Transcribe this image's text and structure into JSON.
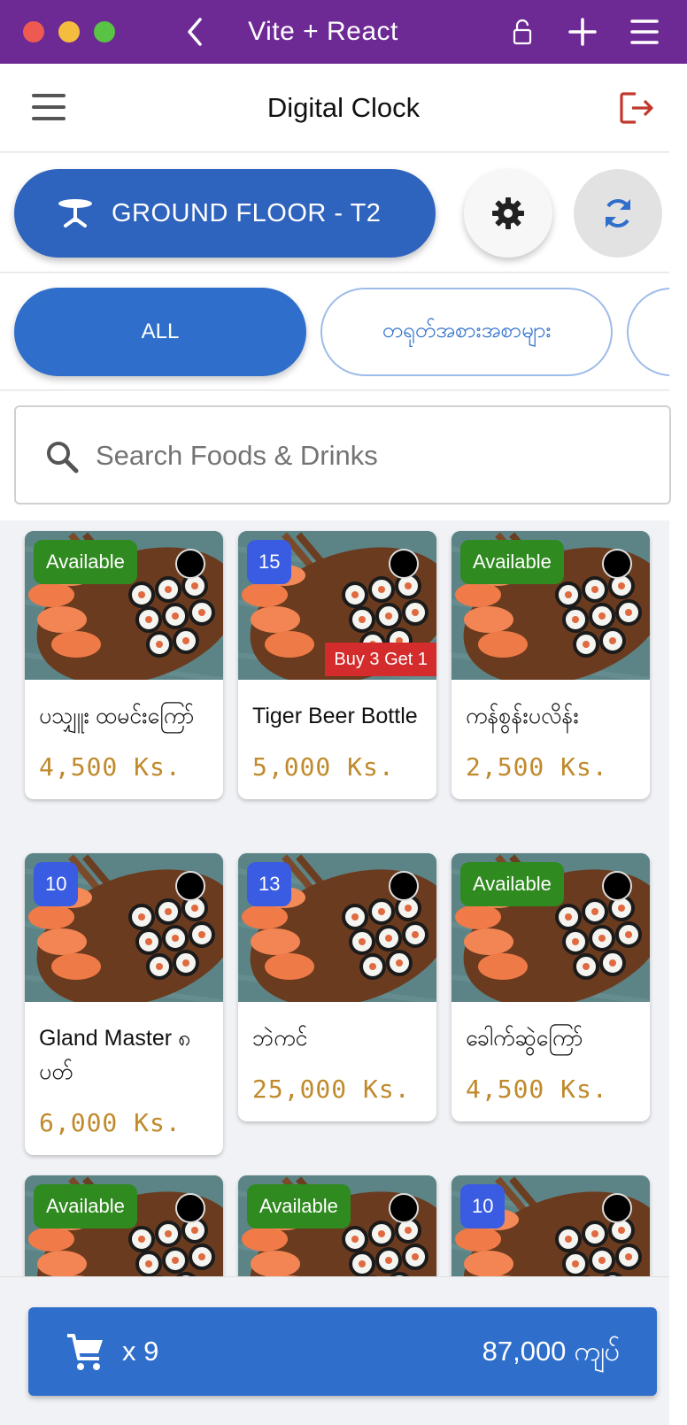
{
  "browser": {
    "title": "Vite + React",
    "icons": [
      "back-icon",
      "lock-icon",
      "plus-icon",
      "menu-icon"
    ]
  },
  "header": {
    "title": "Digital Clock",
    "icons": [
      "hamburger-icon",
      "logout-icon"
    ]
  },
  "floor": {
    "label": "GROUND FLOOR - T2",
    "icon": "table-icon"
  },
  "categories": [
    {
      "label": "ALL",
      "active": true
    },
    {
      "label": "တရုတ်အစားအစာများ",
      "active": false
    },
    {
      "label": "",
      "active": false
    }
  ],
  "search": {
    "placeholder": "Search Foods & Drinks",
    "value": ""
  },
  "items": [
    {
      "name": "ပသျှူး ထမင်းကြော်",
      "price": "4,500 Ks.",
      "badge": "Available",
      "badge_type": "available",
      "promo": ""
    },
    {
      "name": "Tiger Beer Bottle",
      "price": "5,000 Ks.",
      "badge": "15",
      "badge_type": "count",
      "promo": "Buy 3 Get 1"
    },
    {
      "name": "ကန်စွန်းပလိန်း",
      "price": "2,500 Ks.",
      "badge": "Available",
      "badge_type": "available",
      "promo": ""
    },
    {
      "name": "Gland Master ၈ ပတ်",
      "price": "6,000 Ks.",
      "badge": "10",
      "badge_type": "count",
      "promo": ""
    },
    {
      "name": "ဘဲကင်",
      "price": "25,000 Ks.",
      "badge": "13",
      "badge_type": "count",
      "promo": ""
    },
    {
      "name": "ခေါက်ဆွဲကြော်",
      "price": "4,500 Ks.",
      "badge": "Available",
      "badge_type": "available",
      "promo": ""
    },
    {
      "name": "",
      "price": "",
      "badge": "Available",
      "badge_type": "available",
      "promo": ""
    },
    {
      "name": "",
      "price": "",
      "badge": "Available",
      "badge_type": "available",
      "promo": ""
    },
    {
      "name": "",
      "price": "",
      "badge": "10",
      "badge_type": "count",
      "promo": ""
    }
  ],
  "cart": {
    "quantity": "x 9",
    "total": "87,000 ကျပ်",
    "icon": "cart-icon"
  },
  "colors": {
    "titlebar": "#6e2a94",
    "primary": "#2f6fcb",
    "available": "#2f8a1f",
    "count_badge": "#3a5ce3",
    "promo": "#d42c2c",
    "price": "#c08a2c",
    "logout": "#c0392b"
  }
}
